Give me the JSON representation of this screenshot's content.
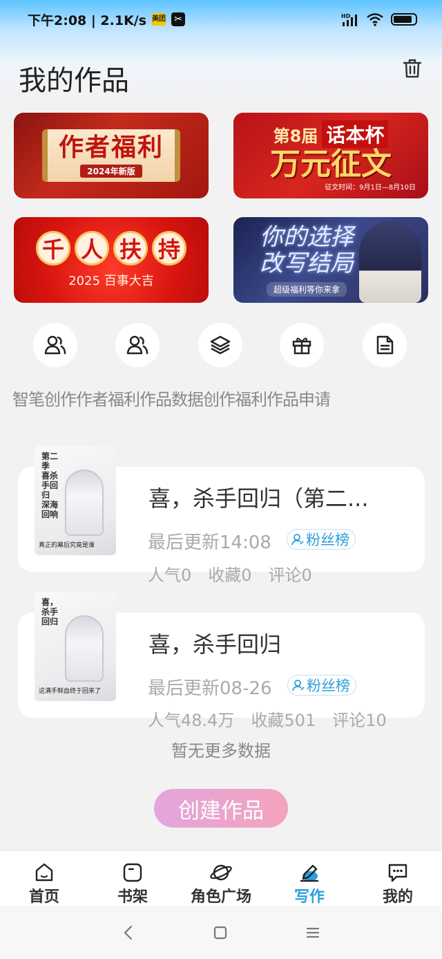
{
  "status_bar": {
    "time_speed": "下午2:08 | 2.1K/s",
    "app_badge_1": "美团",
    "app_badge_2": "✂",
    "network": "HD"
  },
  "header": {
    "title": "我的作品"
  },
  "banners": [
    {
      "main": "作者福利",
      "sub": "2024年新版"
    },
    {
      "prefix": "第8届",
      "cup": "话本杯",
      "main": "万元征文",
      "note": "征文时间：9月1日—8月10日"
    },
    {
      "chars": [
        "千",
        "人",
        "扶",
        "持"
      ],
      "sub": "2025 百事大吉"
    },
    {
      "main_line1": "你的选择",
      "main_line2": "改写结局",
      "sub": "超级福利等你来拿"
    }
  ],
  "quick_labels": "智笔创作作者福利作品数据创作福利作品申请",
  "works": [
    {
      "title": "喜，杀手回归（第二...",
      "updated": "最后更新14:08",
      "badge": "粉丝榜",
      "stats": [
        "人气0",
        "收藏0",
        "评论0"
      ],
      "cover_text": "第二季 喜杀手回归 深海回响",
      "cover_bottom": "真正的幕后究竟是谁"
    },
    {
      "title": "喜，杀手回归",
      "updated": "最后更新08-26",
      "badge": "粉丝榜",
      "stats": [
        "人气48.4万",
        "收藏501",
        "评论10"
      ],
      "cover_text": "喜，杀手回归",
      "cover_bottom": "这满手鲜血终于回来了"
    }
  ],
  "no_more": "暂无更多数据",
  "create_button": "创建作品",
  "bottom_nav": [
    {
      "label": "首页",
      "icon": "home-icon"
    },
    {
      "label": "书架",
      "icon": "bookshelf-icon"
    },
    {
      "label": "角色广场",
      "icon": "planet-icon"
    },
    {
      "label": "写作",
      "icon": "write-icon"
    },
    {
      "label": "我的",
      "icon": "chat-icon"
    }
  ],
  "colors": {
    "accent": "#2a9fe0",
    "create_button_start": "#e2a6dd",
    "create_button_end": "#f4a3bd"
  }
}
